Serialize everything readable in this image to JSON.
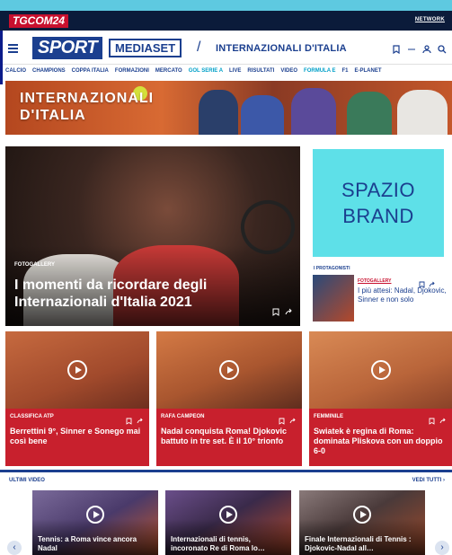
{
  "network": {
    "logo": "TGCOM",
    "logo_num": "24",
    "network_label": "NETWORK"
  },
  "header": {
    "logo_sport": "SPORT",
    "logo_mediaset": "MEDIASET",
    "page_title": "INTERNAZIONALI D'ITALIA"
  },
  "nav": {
    "items": [
      {
        "label": "CALCIO"
      },
      {
        "label": "CHAMPIONS"
      },
      {
        "label": "COPPA ITALIA"
      },
      {
        "label": "FORMAZIONI"
      },
      {
        "label": "MERCATO"
      },
      {
        "label": "GOL SERIE A"
      },
      {
        "label": "LIVE"
      },
      {
        "label": "RISULTATI"
      },
      {
        "label": "VIDEO"
      },
      {
        "label": "FORMULA E"
      },
      {
        "label": "F1"
      },
      {
        "label": "E-PLANET"
      }
    ]
  },
  "banner": {
    "title_line1": "INTERNAZIONALI",
    "title_line2": "D'ITALIA"
  },
  "hero": {
    "tag": "FOTOGALLERY",
    "title": "I momenti da ricordare degli Internazionali d'Italia 2021"
  },
  "brand": {
    "line1": "SPAZIO",
    "line2": "BRAND"
  },
  "preview": {
    "section_label": "I PROTAGONISTI",
    "tag": "FOTOGALLERY",
    "title": "I più attesi: Nadal, Djokovic, Sinner e non solo"
  },
  "cards": [
    {
      "tag": "CLASSIFICA ATP",
      "title": "Berrettini 9°, Sinner e Sonego mai così bene"
    },
    {
      "tag": "RAFA CAMPEON",
      "title": "Nadal conquista Roma! Djokovic battuto in tre set. È il 10° trionfo"
    },
    {
      "tag": "FEMMINILE",
      "title": "Swiatek è regina di Roma: dominata Pliskova con un doppio 6-0"
    }
  ],
  "videos": {
    "section_label": "ULTIMI VIDEO",
    "all_label": "VEDI TUTTI ›",
    "items": [
      {
        "title": "Tennis: a Roma vince ancora Nadal"
      },
      {
        "title": "Internazionali di tennis, incoronato Re di Roma lo…"
      },
      {
        "title": "Finale Internazionali di Tennis : Djokovic-Nadal all…"
      }
    ]
  },
  "arrows": {
    "prev": "‹",
    "next": "›"
  },
  "colors": {
    "primary": "#1b3f8f",
    "accent": "#c8202d",
    "brand_bg": "#5ee0e8",
    "topbar": "#0b1b3a"
  },
  "icons": [
    "hamburger-icon",
    "bookmark-icon",
    "user-icon",
    "search-icon",
    "share-icon",
    "play-icon"
  ]
}
